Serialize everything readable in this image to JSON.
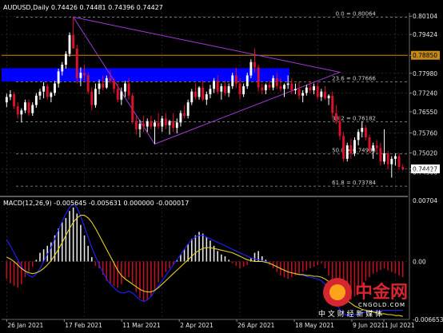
{
  "header": {
    "symbol_line": "AUDUSD,Daily  0.74426 0.74481 0.74396 0.74427"
  },
  "colors": {
    "background": "#000000",
    "grid": "#3a3a3a",
    "bull": "#ffffff",
    "bear": "#e0102a",
    "zone": "#0000ff",
    "hline": "#c58a18",
    "triangle": "#a23bd6",
    "fib": "#9a9a9a",
    "macd_pos": "#e8e8e8",
    "macd_neg": "#c01020",
    "signal": "#e6d21a",
    "main_line": "#2020ff",
    "price_box": "#c58a18"
  },
  "chart_data": [
    {
      "type": "candlestick",
      "title": "AUDUSD,Daily",
      "ohlc_current": {
        "open": 0.74426,
        "high": 0.74481,
        "low": 0.74396,
        "close": 0.74427
      },
      "ylim": [
        0.7352,
        0.8023
      ],
      "y_ticks": [
        0.80104,
        0.79424,
        0.7865,
        0.7798,
        0.7724,
        0.7655,
        0.7576,
        0.7502,
        0.74427,
        0.743
      ],
      "y_tick_labels": [
        "0.80104",
        "0.79424",
        "0.78850",
        "0.77980",
        "0.77240",
        "0.76550",
        "0.75760",
        "0.75020",
        "0.74427",
        "0.74300"
      ],
      "x_labels": [
        "26 Jan 2021",
        "17 Feb 2021",
        "11 Mar 2021",
        "2 Apr 2021",
        "26 Apr 2021",
        "18 May 2021",
        "9 Jun 2021",
        "1 Jul 2021"
      ],
      "current_price_label": "0.74427",
      "horizontal_line": {
        "value": 0.7865,
        "label": "0.78850"
      },
      "resistance_zone": {
        "from": 0.7767,
        "to": 0.7817
      },
      "fib_levels": [
        {
          "label": "0.0 = 0.80064",
          "value": 0.80064
        },
        {
          "label": "23.6 = 0.77666",
          "value": 0.77666
        },
        {
          "label": "38.2 = 0.76182",
          "value": 0.76182
        },
        {
          "label": "50.0 = 0.74983",
          "value": 0.74983
        },
        {
          "label": "61.8 = 0.73784",
          "value": 0.73784
        }
      ],
      "triangle": [
        {
          "bar": 18,
          "value": 0.8007
        },
        {
          "bar": 90,
          "value": 0.7802
        },
        {
          "bar": 40,
          "value": 0.7535
        }
      ],
      "candles": [
        [
          0.769,
          0.7722,
          0.7672,
          0.771
        ],
        [
          0.771,
          0.7735,
          0.7698,
          0.772
        ],
        [
          0.772,
          0.7728,
          0.7665,
          0.7675
        ],
        [
          0.7675,
          0.769,
          0.763,
          0.7645
        ],
        [
          0.7645,
          0.7668,
          0.7615,
          0.766
        ],
        [
          0.766,
          0.77,
          0.765,
          0.769
        ],
        [
          0.769,
          0.77,
          0.764,
          0.765
        ],
        [
          0.765,
          0.769,
          0.764,
          0.768
        ],
        [
          0.768,
          0.7725,
          0.767,
          0.7715
        ],
        [
          0.7715,
          0.774,
          0.77,
          0.773
        ],
        [
          0.773,
          0.7765,
          0.7705,
          0.775
        ],
        [
          0.775,
          0.7758,
          0.77,
          0.771
        ],
        [
          0.771,
          0.773,
          0.769,
          0.7725
        ],
        [
          0.7725,
          0.777,
          0.7715,
          0.776
        ],
        [
          0.776,
          0.7815,
          0.7745,
          0.7805
        ],
        [
          0.7805,
          0.784,
          0.779,
          0.783
        ],
        [
          0.783,
          0.788,
          0.7815,
          0.787
        ],
        [
          0.787,
          0.795,
          0.786,
          0.794
        ],
        [
          0.794,
          0.8007,
          0.7915,
          0.789
        ],
        [
          0.789,
          0.7905,
          0.776,
          0.778
        ],
        [
          0.778,
          0.782,
          0.775,
          0.78
        ],
        [
          0.78,
          0.783,
          0.777,
          0.779
        ],
        [
          0.779,
          0.78,
          0.772,
          0.773
        ],
        [
          0.773,
          0.7745,
          0.766,
          0.768
        ],
        [
          0.768,
          0.776,
          0.767,
          0.774
        ],
        [
          0.774,
          0.7775,
          0.772,
          0.776
        ],
        [
          0.776,
          0.779,
          0.7735,
          0.7745
        ],
        [
          0.7745,
          0.779,
          0.774,
          0.778
        ],
        [
          0.778,
          0.781,
          0.776,
          0.777
        ],
        [
          0.777,
          0.778,
          0.7725,
          0.774
        ],
        [
          0.774,
          0.776,
          0.769,
          0.77
        ],
        [
          0.77,
          0.7745,
          0.768,
          0.773
        ],
        [
          0.773,
          0.777,
          0.771,
          0.776
        ],
        [
          0.776,
          0.778,
          0.77,
          0.7715
        ],
        [
          0.7715,
          0.7725,
          0.761,
          0.762
        ],
        [
          0.762,
          0.764,
          0.757,
          0.759
        ],
        [
          0.759,
          0.7625,
          0.756,
          0.761
        ],
        [
          0.761,
          0.764,
          0.758,
          0.76
        ],
        [
          0.76,
          0.763,
          0.758,
          0.762
        ],
        [
          0.762,
          0.764,
          0.759,
          0.76
        ],
        [
          0.76,
          0.7625,
          0.7535,
          0.7615
        ],
        [
          0.7615,
          0.765,
          0.759,
          0.76
        ],
        [
          0.76,
          0.764,
          0.758,
          0.763
        ],
        [
          0.763,
          0.765,
          0.759,
          0.7605
        ],
        [
          0.7605,
          0.7625,
          0.757,
          0.762
        ],
        [
          0.762,
          0.765,
          0.758,
          0.7595
        ],
        [
          0.7595,
          0.763,
          0.7575,
          0.7615
        ],
        [
          0.7615,
          0.766,
          0.76,
          0.765
        ],
        [
          0.765,
          0.768,
          0.763,
          0.764
        ],
        [
          0.764,
          0.77,
          0.763,
          0.769
        ],
        [
          0.769,
          0.774,
          0.768,
          0.773
        ],
        [
          0.773,
          0.776,
          0.77,
          0.771
        ],
        [
          0.771,
          0.775,
          0.77,
          0.7745
        ],
        [
          0.7745,
          0.777,
          0.7695,
          0.77
        ],
        [
          0.77,
          0.773,
          0.768,
          0.772
        ],
        [
          0.772,
          0.7755,
          0.7705,
          0.774
        ],
        [
          0.774,
          0.778,
          0.7725,
          0.777
        ],
        [
          0.777,
          0.779,
          0.772,
          0.773
        ],
        [
          0.773,
          0.776,
          0.77,
          0.775
        ],
        [
          0.775,
          0.777,
          0.7715,
          0.7725
        ],
        [
          0.7725,
          0.776,
          0.771,
          0.775
        ],
        [
          0.775,
          0.78,
          0.774,
          0.779
        ],
        [
          0.779,
          0.7818,
          0.7745,
          0.776
        ],
        [
          0.776,
          0.778,
          0.77,
          0.772
        ],
        [
          0.772,
          0.776,
          0.771,
          0.775
        ],
        [
          0.775,
          0.78,
          0.774,
          0.779
        ],
        [
          0.779,
          0.785,
          0.778,
          0.784
        ],
        [
          0.784,
          0.789,
          0.78,
          0.782
        ],
        [
          0.782,
          0.783,
          0.773,
          0.7745
        ],
        [
          0.7745,
          0.776,
          0.772,
          0.7735
        ],
        [
          0.7735,
          0.776,
          0.772,
          0.7755
        ],
        [
          0.7755,
          0.777,
          0.7735,
          0.7745
        ],
        [
          0.7745,
          0.779,
          0.7735,
          0.778
        ],
        [
          0.778,
          0.78,
          0.774,
          0.775
        ],
        [
          0.775,
          0.778,
          0.773,
          0.774
        ],
        [
          0.774,
          0.776,
          0.771,
          0.7755
        ],
        [
          0.7755,
          0.779,
          0.774,
          0.776
        ],
        [
          0.776,
          0.778,
          0.772,
          0.7735
        ],
        [
          0.7735,
          0.776,
          0.772,
          0.774
        ],
        [
          0.774,
          0.7765,
          0.77,
          0.7715
        ],
        [
          0.7715,
          0.7735,
          0.769,
          0.7725
        ],
        [
          0.7725,
          0.7755,
          0.7715,
          0.7745
        ],
        [
          0.7745,
          0.777,
          0.7725,
          0.7735
        ],
        [
          0.7735,
          0.776,
          0.772,
          0.775
        ],
        [
          0.775,
          0.7765,
          0.77,
          0.771
        ],
        [
          0.771,
          0.774,
          0.7695,
          0.773
        ],
        [
          0.773,
          0.775,
          0.77,
          0.7705
        ],
        [
          0.7705,
          0.772,
          0.768,
          0.7715
        ],
        [
          0.7715,
          0.773,
          0.763,
          0.765
        ],
        [
          0.765,
          0.768,
          0.761,
          0.762
        ],
        [
          0.762,
          0.764,
          0.755,
          0.7565
        ],
        [
          0.7565,
          0.758,
          0.747,
          0.748
        ],
        [
          0.748,
          0.754,
          0.747,
          0.753
        ],
        [
          0.753,
          0.7555,
          0.748,
          0.75
        ],
        [
          0.75,
          0.756,
          0.749,
          0.755
        ],
        [
          0.755,
          0.759,
          0.753,
          0.758
        ],
        [
          0.758,
          0.762,
          0.756,
          0.7595
        ],
        [
          0.7595,
          0.7605,
          0.755,
          0.756
        ],
        [
          0.756,
          0.757,
          0.75,
          0.751
        ],
        [
          0.751,
          0.754,
          0.748,
          0.753
        ],
        [
          0.753,
          0.755,
          0.75,
          0.752
        ],
        [
          0.752,
          0.754,
          0.7455,
          0.747
        ],
        [
          0.747,
          0.759,
          0.746,
          0.75
        ],
        [
          0.75,
          0.751,
          0.744,
          0.746
        ],
        [
          0.746,
          0.749,
          0.741,
          0.748
        ],
        [
          0.748,
          0.75,
          0.7455,
          0.749
        ],
        [
          0.749,
          0.75,
          0.744,
          0.745
        ],
        [
          0.745,
          0.746,
          0.7436,
          0.7443
        ]
      ]
    },
    {
      "type": "bar",
      "title": "MACD(12,26,9) -0.005645 -0.005631 0.000000 -0.000017",
      "ylim": [
        -0.00665,
        0.0071
      ],
      "y_tick_labels": [
        "0.00704",
        "0.00",
        "-0.006653"
      ],
      "x_labels": [
        "26 Jan 2021",
        "17 Feb 2021",
        "11 Mar 2021",
        "2 Apr 2021",
        "26 Apr 2021",
        "18 May 2021",
        "9 Jun 2021",
        "1 Jul 2021"
      ],
      "histogram": [
        -0.002,
        -0.0025,
        -0.0028,
        -0.003,
        -0.0026,
        -0.0018,
        -0.0012,
        -0.0006,
        0.0002,
        0.001,
        0.0014,
        0.0018,
        0.0022,
        0.003,
        0.0038,
        0.0045,
        0.005,
        0.0058,
        0.0062,
        0.0055,
        0.0042,
        0.003,
        0.0018,
        0.0005,
        -0.0005,
        -0.0008,
        -0.0015,
        -0.0022,
        -0.0025,
        -0.0028,
        -0.003,
        -0.0026,
        -0.002,
        -0.0018,
        -0.0025,
        -0.0035,
        -0.0042,
        -0.0046,
        -0.0044,
        -0.004,
        -0.0032,
        -0.0024,
        -0.0018,
        -0.0012,
        -0.0008,
        -0.0004,
        0.0002,
        0.0008,
        0.0014,
        0.002,
        0.0026,
        0.003,
        0.0034,
        0.0032,
        0.0028,
        0.0024,
        0.0018,
        0.0012,
        0.0008,
        0.0006,
        0.0002,
        -0.0002,
        -0.0005,
        -0.0008,
        -0.0006,
        -0.0004,
        0.0004,
        0.001,
        0.0012,
        0.0006,
        0.0002,
        -0.0004,
        -0.0008,
        -0.0012,
        -0.0016,
        -0.0018,
        -0.002,
        -0.0018,
        -0.0016,
        -0.0014,
        -0.0012,
        -0.001,
        -0.0008,
        -0.0006,
        -0.0004,
        -0.0002,
        -0.0008,
        -0.0016,
        -0.0024,
        -0.0032,
        -0.004,
        -0.0046,
        -0.0048,
        -0.0044,
        -0.004,
        -0.0034,
        -0.0028,
        -0.0022,
        -0.0018,
        -0.0014,
        -0.0012,
        -0.001,
        -0.0008,
        -0.001,
        -0.0012,
        -0.0014,
        -0.0016,
        -0.0018
      ],
      "signal": [
        0.0005,
        0.0003,
        0.0,
        -0.0004,
        -0.0008,
        -0.0011,
        -0.0013,
        -0.0014,
        -0.0013,
        -0.0011,
        -0.0008,
        -0.0004,
        0.0001,
        0.0007,
        0.0014,
        0.0022,
        0.003,
        0.0038,
        0.0045,
        0.005,
        0.0053,
        0.0053,
        0.005,
        0.0045,
        0.0038,
        0.003,
        0.0022,
        0.0014,
        0.0006,
        -0.0002,
        -0.001,
        -0.0016,
        -0.002,
        -0.0023,
        -0.0026,
        -0.0029,
        -0.0032,
        -0.0034,
        -0.0035,
        -0.0035,
        -0.0033,
        -0.003,
        -0.0026,
        -0.0022,
        -0.0018,
        -0.0014,
        -0.001,
        -0.0006,
        -0.0002,
        0.0002,
        0.0006,
        0.001,
        0.0013,
        0.0015,
        0.0016,
        0.0016,
        0.0015,
        0.0014,
        0.0013,
        0.0012,
        0.0011,
        0.001,
        0.0008,
        0.0006,
        0.0004,
        0.0002,
        0.0001,
        0.0,
        0.0,
        0.0,
        -0.0001,
        -0.0002,
        -0.0004,
        -0.0006,
        -0.0008,
        -0.001,
        -0.0012,
        -0.0013,
        -0.0014,
        -0.0015,
        -0.0015,
        -0.0016,
        -0.0016,
        -0.0017,
        -0.0017,
        -0.0018,
        -0.002,
        -0.0023,
        -0.0027,
        -0.0031,
        -0.0036,
        -0.0041,
        -0.0045,
        -0.0048,
        -0.0051,
        -0.0053,
        -0.0055,
        -0.0056,
        -0.0057,
        -0.0058,
        -0.0059,
        -0.006,
        -0.006,
        -0.0061,
        -0.0061,
        -0.0062,
        -0.0062,
        -0.0063
      ],
      "main_line": [
        0.0025,
        0.0018,
        0.001,
        0.0002,
        -0.0006,
        -0.0012,
        -0.0016,
        -0.0018,
        -0.0014,
        -0.0008,
        0.0,
        0.0008,
        0.0016,
        0.0026,
        0.0036,
        0.0046,
        0.0055,
        0.0062,
        0.0066,
        0.0062,
        0.0052,
        0.004,
        0.0028,
        0.0016,
        0.0006,
        -0.0004,
        -0.0012,
        -0.002,
        -0.0026,
        -0.003,
        -0.0034,
        -0.0036,
        -0.0036,
        -0.0034,
        -0.0036,
        -0.004,
        -0.0044,
        -0.0046,
        -0.0044,
        -0.004,
        -0.0034,
        -0.0028,
        -0.0022,
        -0.0016,
        -0.001,
        -0.0004,
        0.0002,
        0.0008,
        0.0014,
        0.002,
        0.0025,
        0.0028,
        0.003,
        0.003,
        0.0028,
        0.0026,
        0.0024,
        0.0022,
        0.002,
        0.0018,
        0.0016,
        0.0014,
        0.0012,
        0.001,
        0.0008,
        0.0006,
        0.0004,
        0.0003,
        0.0002,
        0.0001,
        0.0,
        -0.0002,
        -0.0004,
        -0.0006,
        -0.0008,
        -0.001,
        -0.0012,
        -0.0013,
        -0.0014,
        -0.0015,
        -0.0016,
        -0.0017,
        -0.0018,
        -0.0019,
        -0.002,
        -0.0022,
        -0.0026,
        -0.0032,
        -0.004,
        -0.0048,
        -0.0055,
        -0.006,
        -0.0062,
        -0.0062,
        -0.0061,
        -0.006,
        -0.0059,
        -0.0058,
        -0.0057,
        -0.0057,
        -0.0057,
        -0.0056,
        -0.0056,
        -0.0056,
        -0.0056,
        -0.0056,
        -0.0056,
        -0.0056
      ]
    }
  ],
  "watermark": {
    "brand": "中金网",
    "domain": "CNGOLD.COM",
    "slogan": "中 文 财 经 新 媒 体"
  }
}
